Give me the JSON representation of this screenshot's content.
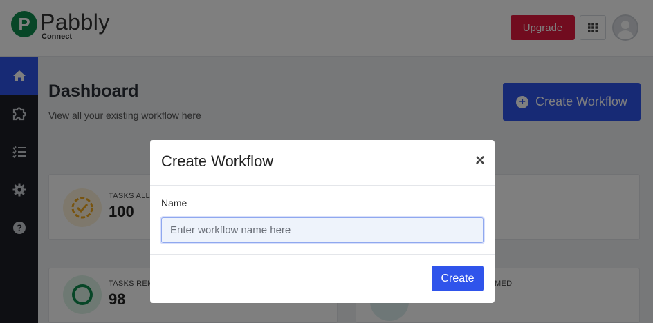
{
  "header": {
    "logo_name": "Pabbly",
    "logo_sub": "Connect",
    "logo_letter": "P",
    "upgrade_label": "Upgrade",
    "apps_icon": "grid-icon",
    "avatar_icon": "user-avatar-icon"
  },
  "sidebar": {
    "items": [
      {
        "icon": "home-icon",
        "active": true
      },
      {
        "icon": "integrations-icon",
        "active": false
      },
      {
        "icon": "task-list-icon",
        "active": false
      },
      {
        "icon": "gear-icon",
        "active": false
      },
      {
        "icon": "help-icon",
        "active": false
      }
    ]
  },
  "main": {
    "title": "Dashboard",
    "subtitle": "View all your existing workflow here",
    "create_workflow_label": "Create Workflow",
    "stats": {
      "tasks_allotted_label": "TASKS ALL",
      "tasks_allotted_value": "100",
      "tasks_remaining_label": "TASKS REM",
      "tasks_remaining_value": "98",
      "tasks_consumed_label": "MED"
    }
  },
  "modal": {
    "title": "Create Workflow",
    "close_glyph": "×",
    "name_label": "Name",
    "name_placeholder": "Enter workflow name here",
    "name_value": "",
    "create_label": "Create"
  },
  "colors": {
    "brand_green": "#0e8c4f",
    "primary_blue": "#2f54eb",
    "upgrade_red": "#e3193f",
    "sidebar_dark": "#1c1f26"
  }
}
